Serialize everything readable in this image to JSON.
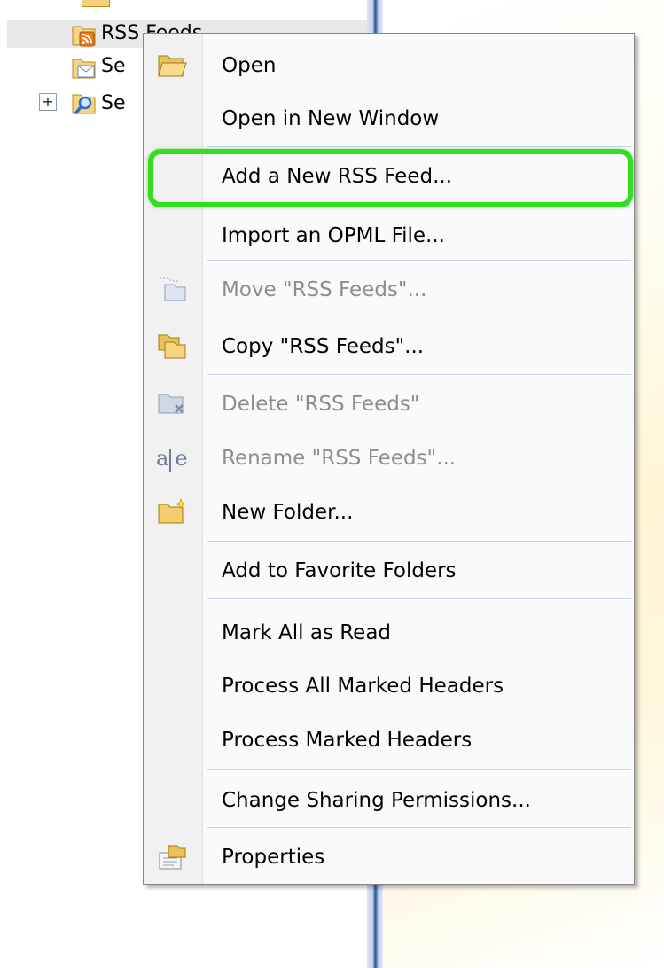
{
  "tree": {
    "items": [
      {
        "label": "RSS Feeds",
        "icon": "rss-folder-icon"
      },
      {
        "label": "Se",
        "icon": "sent-folder-icon"
      },
      {
        "label": "Se",
        "icon": "search-folder-icon"
      }
    ],
    "expand_symbol": "⊞"
  },
  "menu": {
    "items": [
      {
        "label": "Open",
        "icon": "open-folder-icon",
        "enabled": true
      },
      {
        "label": "Open in New Window",
        "icon": "",
        "enabled": true
      },
      {
        "label": "Add a New RSS Feed...",
        "icon": "",
        "enabled": true
      },
      {
        "label": "Import an OPML File...",
        "icon": "",
        "enabled": true
      },
      {
        "label": "Move \"RSS Feeds\"...",
        "icon": "move-folder-icon",
        "enabled": false
      },
      {
        "label": "Copy \"RSS Feeds\"...",
        "icon": "copy-folder-icon",
        "enabled": true
      },
      {
        "label": "Delete \"RSS Feeds\"",
        "icon": "delete-folder-icon",
        "enabled": false
      },
      {
        "label": "Rename \"RSS Feeds\"...",
        "icon": "rename-icon",
        "enabled": false
      },
      {
        "label": "New Folder...",
        "icon": "new-folder-icon",
        "enabled": true
      },
      {
        "label": "Add to Favorite Folders",
        "icon": "",
        "enabled": true
      },
      {
        "label": "Mark All as Read",
        "icon": "",
        "enabled": true
      },
      {
        "label": "Process All Marked Headers",
        "icon": "",
        "enabled": true
      },
      {
        "label": "Process Marked Headers",
        "icon": "",
        "enabled": true
      },
      {
        "label": "Change Sharing Permissions...",
        "icon": "",
        "enabled": true
      },
      {
        "label": "Properties",
        "icon": "properties-icon",
        "enabled": true
      }
    ],
    "rename_glyph": "a|e"
  },
  "colors": {
    "highlight": "#33dd22",
    "disabled_text": "#8d8d8d",
    "splitter": "#2f5597"
  }
}
